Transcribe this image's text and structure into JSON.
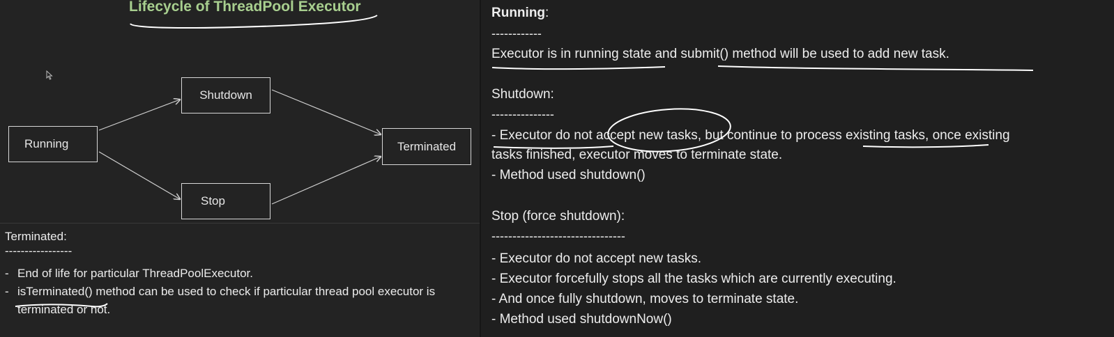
{
  "diagram": {
    "title": "Lifecycle of ThreadPool Executor",
    "nodes": {
      "running": "Running",
      "shutdown": "Shutdown",
      "stop": "Stop",
      "terminated": "Terminated"
    }
  },
  "terminated_section": {
    "heading": "Terminated:",
    "dashes": "-----------------",
    "items": [
      "End of life for particular ThreadPoolExecutor.",
      "isTerminated() method can be used to check if particular thread pool executor is terminated or not."
    ]
  },
  "notes": {
    "running": {
      "heading": "Running",
      "heading_suffix": ":",
      "dashes": "------------",
      "text": "Executor is in running state and submit() method will be used to add new task."
    },
    "shutdown": {
      "heading": "Shutdown:",
      "dashes": "---------------",
      "line1": "- Executor do not accept new tasks, but continue to process existing tasks, once existing",
      "line2": "tasks finished, executor moves to terminate state.",
      "line3": "- Method used shutdown()"
    },
    "stop": {
      "heading": "Stop (force shutdown):",
      "dashes": "--------------------------------",
      "items": [
        "-  Executor do not accept new tasks.",
        "-  Executor forcefully stops all the tasks which are currently executing.",
        "-  And once fully shutdown, moves to terminate state.",
        "-  Method used shutdownNow()"
      ]
    }
  },
  "colors": {
    "title": "#a8cf8f",
    "background": "#232323",
    "text": "#ececec",
    "ink": "#ffffff"
  },
  "icons": [
    "mouse-cursor-icon"
  ]
}
